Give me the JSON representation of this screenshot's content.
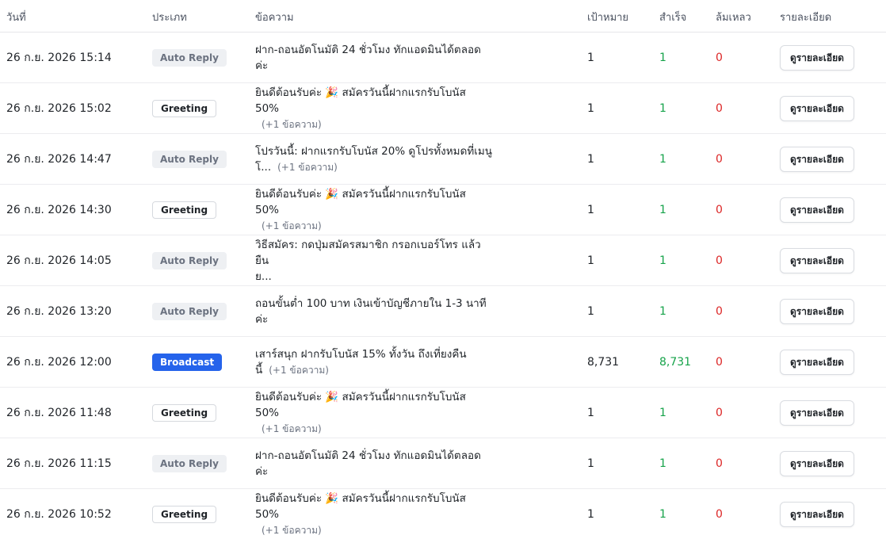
{
  "header": {
    "date": "วันที่",
    "type": "ประเภท",
    "message": "ข้อความ",
    "target": "เป้าหมาย",
    "success": "สำเร็จ",
    "failed": "ล้มเหลว",
    "detail": "รายละเอียด"
  },
  "detail_button_label": "ดูรายละเอียด",
  "colors": {
    "success": "#16a34a",
    "failed": "#dc2626",
    "broadcast": "#2563eb"
  },
  "rows": [
    {
      "date": "26 ก.ย. 2026 15:14",
      "type": "Auto Reply",
      "type_key": "auto",
      "msg_line1": "ฝาก-ถอนอัตโนมัติ 24 ชั่วโมง ทักแอดมินได้ตลอดค่ะ",
      "msg_line2": "",
      "more": "",
      "target": "1",
      "success": "1",
      "failed": "0"
    },
    {
      "date": "26 ก.ย. 2026 15:02",
      "type": "Greeting",
      "type_key": "greeting",
      "msg_line1": "ยินดีต้อนรับค่ะ 🎉 สมัครวันนี้ฝากแรกรับโบนัส 50%",
      "msg_line2": "",
      "more": "(+1 ข้อความ)",
      "target": "1",
      "success": "1",
      "failed": "0"
    },
    {
      "date": "26 ก.ย. 2026 14:47",
      "type": "Auto Reply",
      "type_key": "auto",
      "msg_line1": "โปรวันนี้: ฝากแรกรับโบนัส 20% ดูโปรทั้งหมดที่เมนู",
      "msg_line2": "โ...",
      "more": "(+1 ข้อความ)",
      "target": "1",
      "success": "1",
      "failed": "0"
    },
    {
      "date": "26 ก.ย. 2026 14:30",
      "type": "Greeting",
      "type_key": "greeting",
      "msg_line1": "ยินดีต้อนรับค่ะ 🎉 สมัครวันนี้ฝากแรกรับโบนัส 50%",
      "msg_line2": "",
      "more": "(+1 ข้อความ)",
      "target": "1",
      "success": "1",
      "failed": "0"
    },
    {
      "date": "26 ก.ย. 2026 14:05",
      "type": "Auto Reply",
      "type_key": "auto",
      "msg_line1": "วิธีสมัคร: กดปุ่มสมัครสมาชิก กรอกเบอร์โทร แล้วยืน",
      "msg_line2": "ย...",
      "more": "",
      "target": "1",
      "success": "1",
      "failed": "0"
    },
    {
      "date": "26 ก.ย. 2026 13:20",
      "type": "Auto Reply",
      "type_key": "auto",
      "msg_line1": "ถอนขั้นต่ำ 100 บาท เงินเข้าบัญชีภายใน 1-3 นาทีค่ะ",
      "msg_line2": "",
      "more": "",
      "target": "1",
      "success": "1",
      "failed": "0"
    },
    {
      "date": "26 ก.ย. 2026 12:00",
      "type": "Broadcast",
      "type_key": "broadcast",
      "msg_line1": "เสาร์สนุก ฝากรับโบนัส 15% ทั้งวัน ถึงเที่ยงคืนนี้",
      "msg_line2": "",
      "more": "(+1 ข้อความ)",
      "target": "8,731",
      "success": "8,731",
      "failed": "0"
    },
    {
      "date": "26 ก.ย. 2026 11:48",
      "type": "Greeting",
      "type_key": "greeting",
      "msg_line1": "ยินดีต้อนรับค่ะ 🎉 สมัครวันนี้ฝากแรกรับโบนัส 50%",
      "msg_line2": "",
      "more": "(+1 ข้อความ)",
      "target": "1",
      "success": "1",
      "failed": "0"
    },
    {
      "date": "26 ก.ย. 2026 11:15",
      "type": "Auto Reply",
      "type_key": "auto",
      "msg_line1": "ฝาก-ถอนอัตโนมัติ 24 ชั่วโมง ทักแอดมินได้ตลอดค่ะ",
      "msg_line2": "",
      "more": "",
      "target": "1",
      "success": "1",
      "failed": "0"
    },
    {
      "date": "26 ก.ย. 2026 10:52",
      "type": "Greeting",
      "type_key": "greeting",
      "msg_line1": "ยินดีต้อนรับค่ะ 🎉 สมัครวันนี้ฝากแรกรับโบนัส 50%",
      "msg_line2": "",
      "more": "(+1 ข้อความ)",
      "target": "1",
      "success": "1",
      "failed": "0"
    }
  ]
}
